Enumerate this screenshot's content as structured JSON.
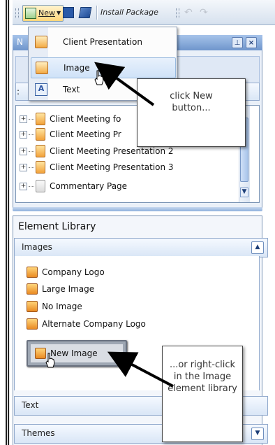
{
  "toolbar": {
    "new_label": "New",
    "install_label": "Install Package"
  },
  "panel1": {
    "title": "N",
    "pin_glyph": "📌",
    "close_glyph": "×",
    "tree_items": [
      "Client Meeting fo",
      "Client Meeting Pr",
      "Client Meeting Presentation 2",
      "Client Meeting Presentation 3",
      "Commentary Page"
    ]
  },
  "new_menu": {
    "items": [
      {
        "label": "Client Presentation",
        "icon": "presentation-icon"
      },
      {
        "label": "Image",
        "icon": "image-icon"
      },
      {
        "label": "Text",
        "icon": "text-icon"
      }
    ]
  },
  "library": {
    "title": "Element Library",
    "images_bar": "Images",
    "images": [
      "Company Logo",
      "Large Image",
      "No Image",
      "Alternate Company Logo"
    ],
    "new_image_label": "New Image",
    "text_bar": "Text",
    "themes_bar": "Themes"
  },
  "callouts": {
    "first": "click New button...",
    "second": "...or right-click in the Image element library"
  },
  "colors": {
    "header_blue": "#6f96cc",
    "orange_icon": "#e98a22",
    "arrow": "#000000"
  }
}
